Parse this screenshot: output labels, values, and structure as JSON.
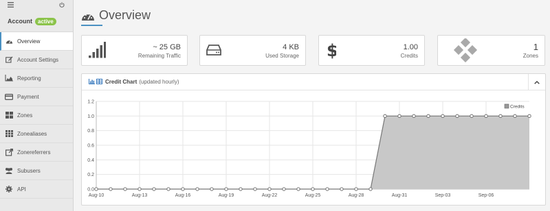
{
  "sidebar": {
    "account_label": "Account",
    "account_badge": "active",
    "items": [
      {
        "label": "Overview",
        "icon": "dashboard-icon",
        "active": true
      },
      {
        "label": "Account Settings",
        "icon": "edit-icon"
      },
      {
        "label": "Reporting",
        "icon": "area-chart-icon"
      },
      {
        "label": "Payment",
        "icon": "credit-card-icon"
      },
      {
        "label": "Zones",
        "icon": "grid-icon"
      },
      {
        "label": "Zonealiases",
        "icon": "grid-small-icon"
      },
      {
        "label": "Zonereferrers",
        "icon": "external-link-icon"
      },
      {
        "label": "Subusers",
        "icon": "users-icon"
      },
      {
        "label": "API",
        "icon": "gear-icon"
      }
    ]
  },
  "header": {
    "title": "Overview"
  },
  "stats": [
    {
      "value": "~ 25 GB",
      "label": "Remaining Traffic",
      "icon": "signal-icon"
    },
    {
      "value": "4 KB",
      "label": "Used Storage",
      "icon": "hdd-icon"
    },
    {
      "value": "1.00",
      "label": "Credits",
      "icon": "dollar-icon"
    },
    {
      "value": "1",
      "label": "Zones",
      "icon": "zones-icon"
    }
  ],
  "panel": {
    "title": "Credit Chart",
    "subtitle": "(updated hourly)"
  },
  "colors": {
    "accent": "#4a90c2",
    "badge": "#8bc34a",
    "area_fill": "#c8c8c8",
    "line": "#777777"
  },
  "chart_data": {
    "type": "area",
    "x": [
      "Aug-10",
      "Aug-11",
      "Aug-12",
      "Aug-13",
      "Aug-14",
      "Aug-15",
      "Aug-16",
      "Aug-17",
      "Aug-18",
      "Aug-19",
      "Aug-20",
      "Aug-21",
      "Aug-22",
      "Aug-23",
      "Aug-24",
      "Aug-25",
      "Aug-26",
      "Aug-27",
      "Aug-28",
      "Aug-29",
      "Aug-30",
      "Aug-31",
      "Sep-01",
      "Sep-02",
      "Sep-03",
      "Sep-04",
      "Sep-05",
      "Sep-06",
      "Sep-07",
      "Sep-08",
      "Sep-09"
    ],
    "x_tick_labels": [
      "Aug-10",
      "Aug-13",
      "Aug-16",
      "Aug-19",
      "Aug-22",
      "Aug-25",
      "Aug-28",
      "Aug-31",
      "Sep-03",
      "Sep-06"
    ],
    "series": [
      {
        "name": "Credits",
        "values": [
          0,
          0,
          0,
          0,
          0,
          0,
          0,
          0,
          0,
          0,
          0,
          0,
          0,
          0,
          0,
          0,
          0,
          0,
          0,
          0,
          1,
          1,
          1,
          1,
          1,
          1,
          1,
          1,
          1,
          1,
          1
        ]
      }
    ],
    "ylim": [
      0,
      1.2
    ],
    "y_ticks": [
      "0.0",
      "0.2",
      "0.4",
      "0.6",
      "0.8",
      "1.0",
      "1.2"
    ],
    "grid": true,
    "legend": "top-right"
  }
}
